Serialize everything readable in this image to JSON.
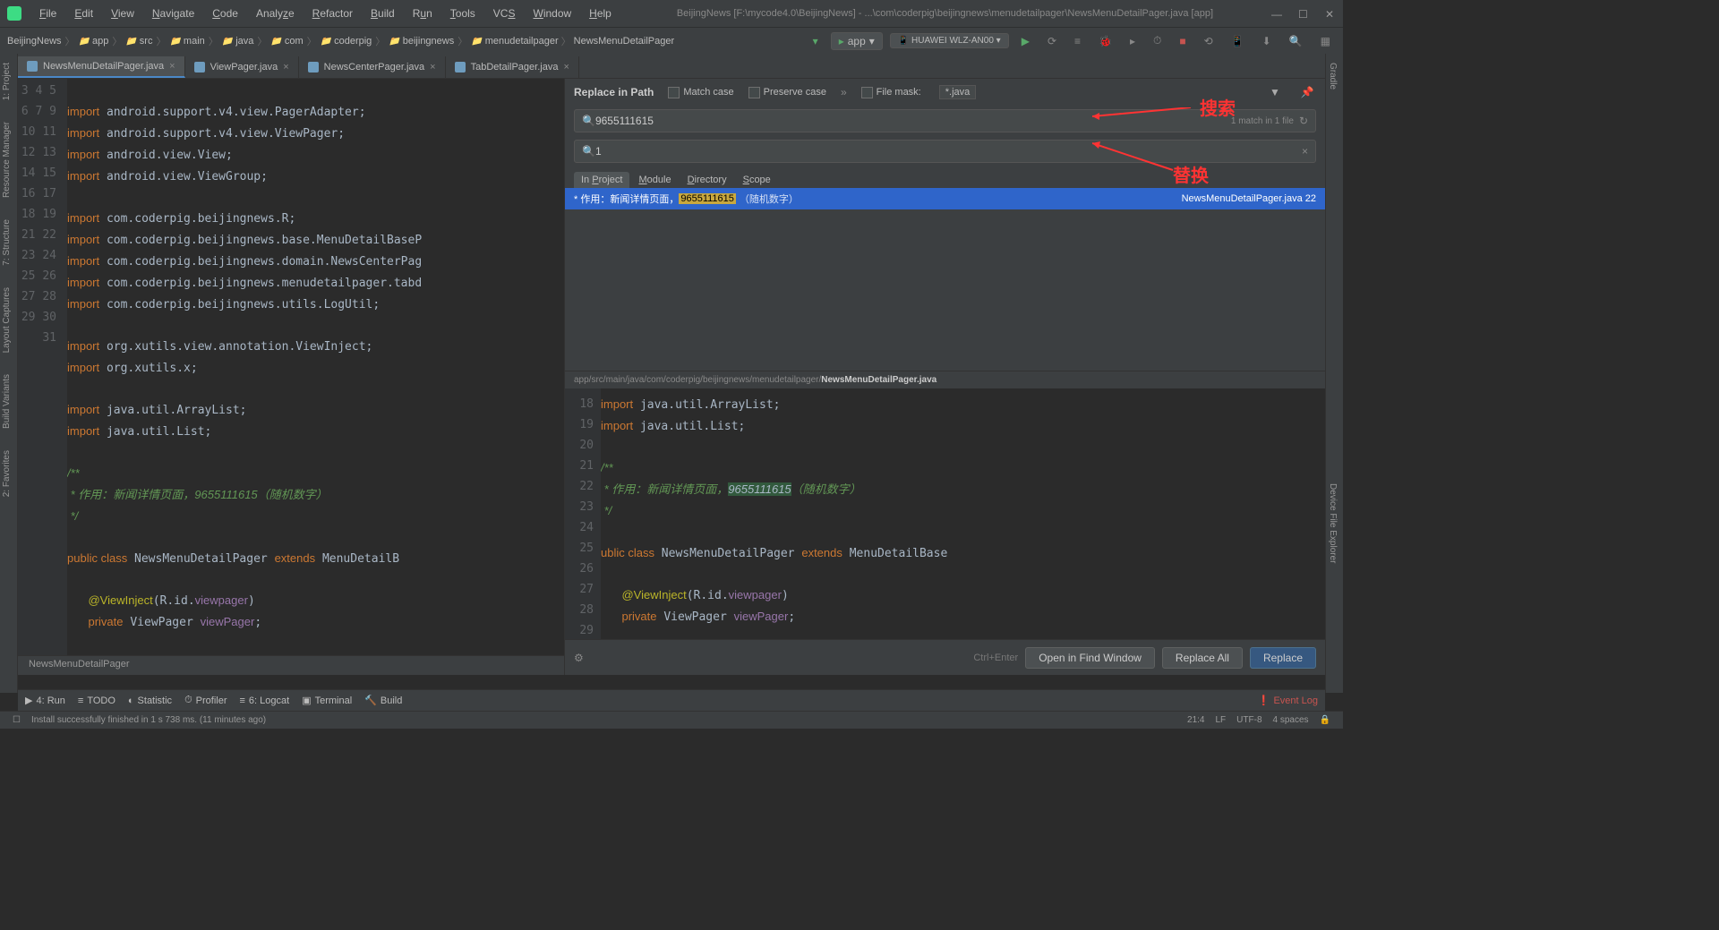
{
  "window_title": "BeijingNews [F:\\mycode4.0\\BeijingNews] - ...\\com\\coderpig\\beijingnews\\menudetailpager\\NewsMenuDetailPager.java [app]",
  "menubar": [
    "File",
    "Edit",
    "View",
    "Navigate",
    "Code",
    "Analyze",
    "Refactor",
    "Build",
    "Run",
    "Tools",
    "VCS",
    "Window",
    "Help"
  ],
  "breadcrumb": [
    "BeijingNews",
    "app",
    "src",
    "main",
    "java",
    "com",
    "coderpig",
    "beijingnews",
    "menudetailpager",
    "NewsMenuDetailPager"
  ],
  "run_config": "app",
  "device": "HUAWEI WLZ-AN00 ▾",
  "tabs": [
    {
      "name": "NewsMenuDetailPager.java",
      "active": true
    },
    {
      "name": "ViewPager.java",
      "active": false
    },
    {
      "name": "NewsCenterPager.java",
      "active": false
    },
    {
      "name": "TabDetailPager.java",
      "active": false
    }
  ],
  "left_tools": [
    "1: Project",
    "Resource Manager",
    "7: Structure",
    "Layout Captures",
    "Build Variants",
    "2: Favorites"
  ],
  "right_tools": [
    "Gradle",
    "Device File Explorer"
  ],
  "editor": {
    "lines_start": 3,
    "lines_end": 31,
    "context_label": "NewsMenuDetailPager"
  },
  "replace": {
    "title": "Replace in Path",
    "match_case": "Match case",
    "preserve_case": "Preserve case",
    "file_mask_label": "File mask:",
    "file_mask_value": "*.java",
    "search_value": "9655111615",
    "search_count": "1 match in 1 file",
    "replace_value": "1",
    "tabs": [
      "In Project",
      "Module",
      "Directory",
      "Scope"
    ],
    "result_prefix": "* 作用：新闻详情页面，",
    "result_highlight": "9655111615",
    "result_suffix": "（随机数字）",
    "result_location": "NewsMenuDetailPager.java 22",
    "preview_path_dim": "app/src/main/java/com/coderpig/beijingnews/menudetailpager/",
    "preview_path_bold": "NewsMenuDetailPager.java",
    "hint": "Ctrl+Enter",
    "btn_open": "Open in Find Window",
    "btn_replace_all": "Replace All",
    "btn_replace": "Replace"
  },
  "annot_search": "搜索",
  "annot_replace": "替换",
  "toolwin": {
    "run": "4: Run",
    "todo": "TODO",
    "statistic": "Statistic",
    "profiler": "Profiler",
    "logcat": "6: Logcat",
    "terminal": "Terminal",
    "build": "Build",
    "event_log": "Event Log"
  },
  "status": {
    "msg": "Install successfully finished in 1 s 738 ms. (11 minutes ago)",
    "pos": "21:4",
    "le": "LF",
    "enc": "UTF-8",
    "indent": "4 spaces"
  }
}
